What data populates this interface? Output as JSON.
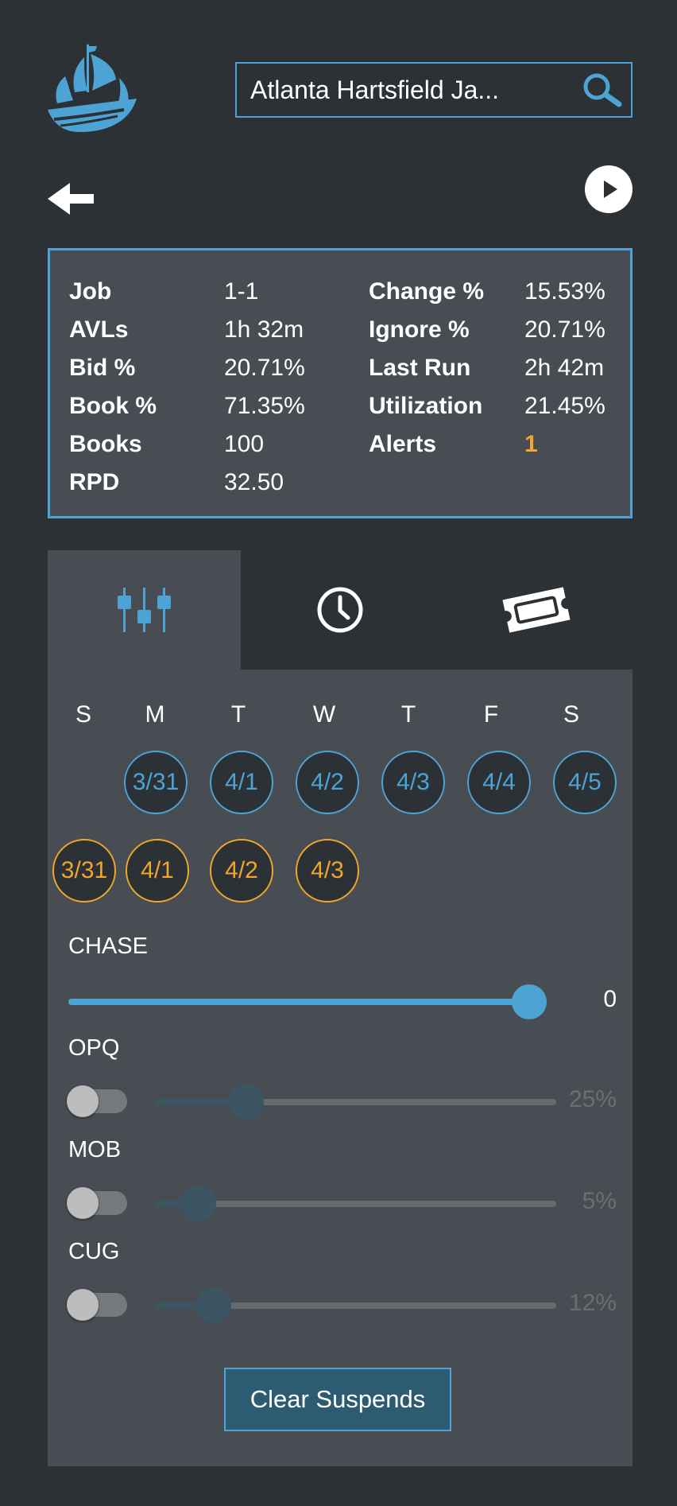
{
  "search": {
    "value": "Atlanta Hartsfield Ja..."
  },
  "icons": {
    "logo": "ship-logo-icon",
    "search": "search-icon",
    "back": "back-arrow-icon",
    "play": "play-icon",
    "tab_filters": "sliders-icon",
    "tab_history": "clock-icon",
    "tab_tickets": "ticket-icon"
  },
  "stats": {
    "left": [
      {
        "label": "Job",
        "value": "1-1"
      },
      {
        "label": "AVLs",
        "value": "1h 32m"
      },
      {
        "label": "Bid %",
        "value": "20.71%"
      },
      {
        "label": "Book %",
        "value": "71.35%"
      },
      {
        "label": "Books",
        "value": "100"
      },
      {
        "label": "RPD",
        "value": "32.50"
      }
    ],
    "right": [
      {
        "label": "Change %",
        "value": "15.53%"
      },
      {
        "label": "Ignore %",
        "value": "20.71%"
      },
      {
        "label": "Last Run",
        "value": "2h 42m"
      },
      {
        "label": "Utilization",
        "value": "21.45%"
      },
      {
        "label": "Alerts",
        "value": "1"
      }
    ]
  },
  "calendar": {
    "days": [
      "S",
      "M",
      "T",
      "W",
      "T",
      "F",
      "S"
    ],
    "blue_dates": [
      "3/31",
      "4/1",
      "4/2",
      "4/3",
      "4/4",
      "4/5"
    ],
    "orange_dates": [
      "3/31",
      "4/1",
      "4/2",
      "4/3"
    ]
  },
  "sliders": {
    "chase": {
      "label": "CHASE",
      "value": "0",
      "level": 1.0
    },
    "opq": {
      "label": "OPQ",
      "value": "25%",
      "enabled": false,
      "level": 0.2
    },
    "mob": {
      "label": "MOB",
      "value": "5%",
      "enabled": false,
      "level": 0.07
    },
    "cug": {
      "label": "CUG",
      "value": "12%",
      "enabled": false,
      "level": 0.11
    }
  },
  "clear_button": {
    "label": "Clear Suspends"
  },
  "colors": {
    "accent": "#4da3d4",
    "alert": "#f0a52e",
    "background": "#2b3134",
    "panel": "#474d52"
  }
}
